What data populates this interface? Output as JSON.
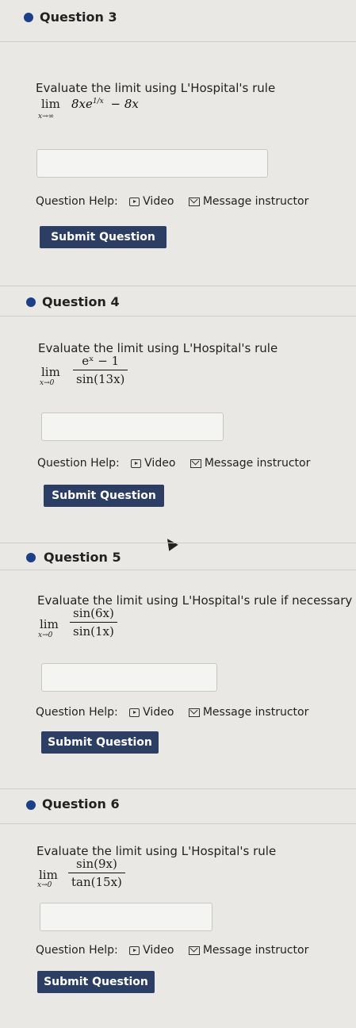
{
  "questions": [
    {
      "title": "Question 3",
      "prompt": "Evaluate the limit using L'Hospital's rule",
      "lim": "lim",
      "lim_sub": "x→∞",
      "expr": "8xe",
      "expr_exp": "1/x",
      "expr_tail": "− 8x",
      "help_label": "Question Help:",
      "video_label": "Video",
      "message_label": "Message instructor",
      "submit_label": "Submit Question"
    },
    {
      "title": "Question 4",
      "prompt": "Evaluate the limit using L'Hospital's rule",
      "lim": "lim",
      "lim_sub": "x→0",
      "numerator": "eˣ − 1",
      "denominator": "sin(13x)",
      "help_label": "Question Help:",
      "video_label": "Video",
      "message_label": "Message instructor",
      "submit_label": "Submit Question"
    },
    {
      "title": "Question 5",
      "prompt": "Evaluate the limit using L'Hospital's rule if necessary",
      "lim": "lim",
      "lim_sub": "x→0",
      "numerator": "sin(6x)",
      "denominator": "sin(1x)",
      "help_label": "Question Help:",
      "video_label": "Video",
      "message_label": "Message instructor",
      "submit_label": "Submit Question"
    },
    {
      "title": "Question 6",
      "prompt": "Evaluate the limit using L'Hospital's rule",
      "lim": "lim",
      "lim_sub": "x→0",
      "numerator": "sin(9x)",
      "denominator": "tan(15x)",
      "help_label": "Question Help:",
      "video_label": "Video",
      "message_label": "Message instructor",
      "submit_label": "Submit Question"
    }
  ]
}
